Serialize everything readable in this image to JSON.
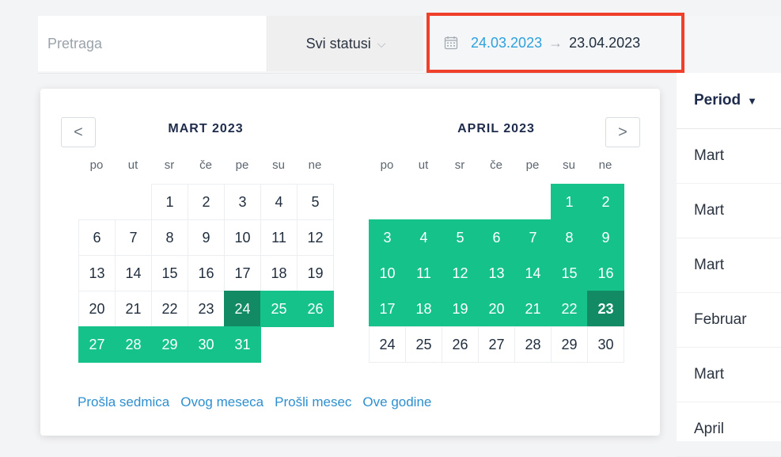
{
  "search": {
    "placeholder": "Pretraga"
  },
  "status_filter": {
    "label": "Svi statusi"
  },
  "date_range": {
    "from": "24.03.2023",
    "arrow": "→",
    "to": "23.04.2023"
  },
  "table": {
    "header": "Period",
    "rows": [
      "Mart",
      "Mart",
      "Mart",
      "Februar",
      "Mart",
      "April"
    ]
  },
  "calendar": {
    "prev": "<",
    "next": ">",
    "weekdays": [
      "po",
      "ut",
      "sr",
      "če",
      "pe",
      "su",
      "ne"
    ],
    "months": [
      {
        "title": "MART 2023",
        "offset": 2,
        "days": 31,
        "range_start": 24,
        "range_end": 31
      },
      {
        "title": "APRIL 2023",
        "offset": 5,
        "days": 30,
        "range_start": 1,
        "range_end": 23
      }
    ],
    "presets": [
      "Prošla sedmica",
      "Ovog meseca",
      "Prošli mesec",
      "Ove godine"
    ]
  },
  "colors": {
    "accent": "#2ea1dd",
    "range": "#14c28a",
    "range_edge": "#128a63",
    "highlight_box": "#f0402c"
  }
}
